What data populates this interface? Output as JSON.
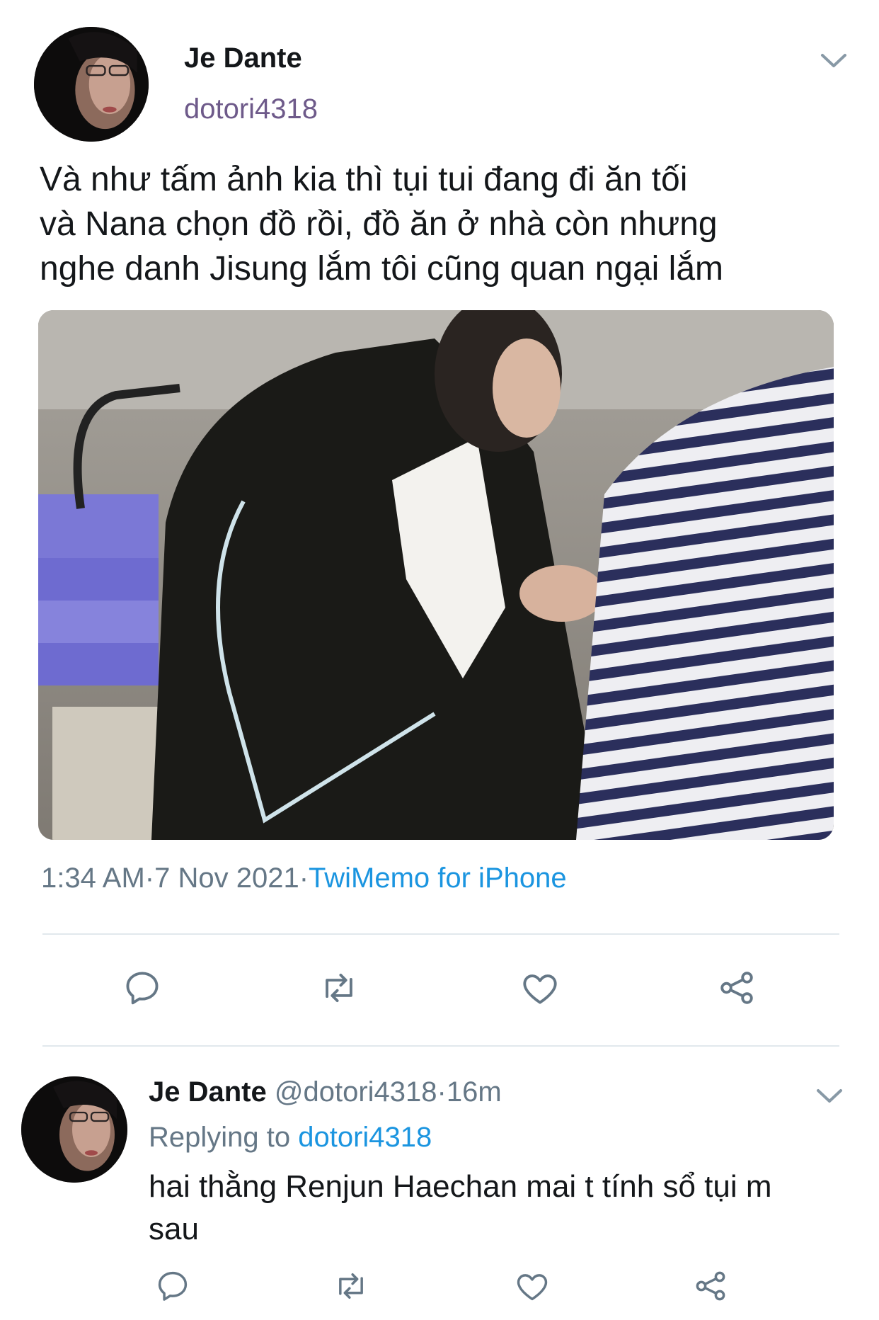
{
  "tweet": {
    "author_name": "Je Dante",
    "author_handle": "dotori4318",
    "text": "Và như tấm ảnh kia thì tụi tui đang đi ăn tối\nvà Nana chọn đồ rồi, đồ ăn ở nhà còn nhưng\nnghe danh Jisung lắm tôi cũng quan ngại lắm",
    "time": "1:34 AM",
    "date": "7 Nov 2021",
    "source": "TwiMemo for iPhone",
    "actions": [
      "reply-icon",
      "retweet-icon",
      "like-icon",
      "share-icon"
    ]
  },
  "reply": {
    "author_name": "Je Dante",
    "author_handle": "@dotori4318",
    "age": "16m",
    "replying_label": "Replying to",
    "replying_to": "dotori4318",
    "text": "hai thằng Renjun Haechan mai t tính sổ tụi m sau",
    "actions": [
      "reply-icon",
      "retweet-icon",
      "like-icon",
      "share-icon"
    ]
  },
  "colors": {
    "text": "#14171a",
    "muted": "#657786",
    "link": "#1b95e0",
    "handle": "#6e5a8a",
    "divider": "#e1e8ed",
    "icon": "#657786"
  }
}
